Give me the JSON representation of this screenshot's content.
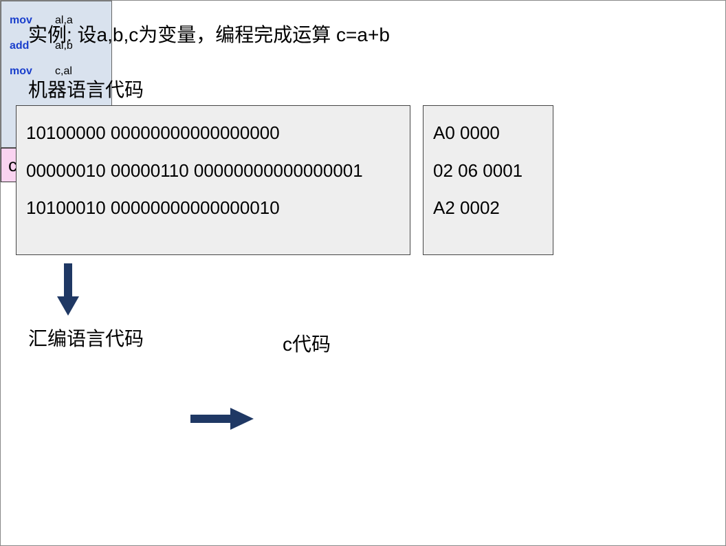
{
  "title": "实例: 设a,b,c为变量，编程完成运算 c=a+b",
  "labels": {
    "machine": "机器语言代码",
    "assembly": "汇编语言代码",
    "c": "c代码"
  },
  "binary": {
    "line1": "10100000 00000000000000000",
    "line2": "00000010 00000110 00000000000000001",
    "line3": "10100010 00000000000000010"
  },
  "hex": {
    "line1": "A0 0000",
    "line2": "02 06 0001",
    "line3": "A2 0002"
  },
  "asm": {
    "line1_op": "mov",
    "line1_arg": "al,a",
    "line2_op": "add",
    "line2_arg": "al,b",
    "line3_op": "mov",
    "line3_arg": "c,al"
  },
  "c_code": "c = a+b"
}
